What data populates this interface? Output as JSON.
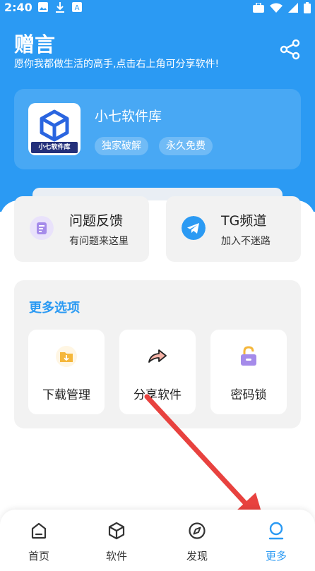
{
  "status": {
    "time": "2:40"
  },
  "header": {
    "title": "赠言",
    "subtitle": "愿你我都做生活的高手,点击右上角可分享软件!"
  },
  "app": {
    "name": "小七软件库",
    "icon_label": "小七软件库",
    "tags": [
      "独家破解",
      "永久免费"
    ]
  },
  "quick": [
    {
      "title": "问题反馈",
      "sub": "有问题来这里"
    },
    {
      "title": "TG频道",
      "sub": "加入不迷路"
    }
  ],
  "more": {
    "title": "更多选项",
    "options": [
      {
        "label": "下载管理",
        "icon": "folder-download-icon"
      },
      {
        "label": "分享软件",
        "icon": "share-arrow-icon"
      },
      {
        "label": "密码锁",
        "icon": "lock-icon"
      }
    ]
  },
  "tabs": [
    {
      "label": "首页",
      "icon": "home-icon"
    },
    {
      "label": "软件",
      "icon": "cube-icon"
    },
    {
      "label": "发现",
      "icon": "compass-icon"
    },
    {
      "label": "更多",
      "icon": "user-icon",
      "active": true
    }
  ],
  "colors": {
    "accent": "#2b9af3",
    "arrow": "#e8423f"
  }
}
